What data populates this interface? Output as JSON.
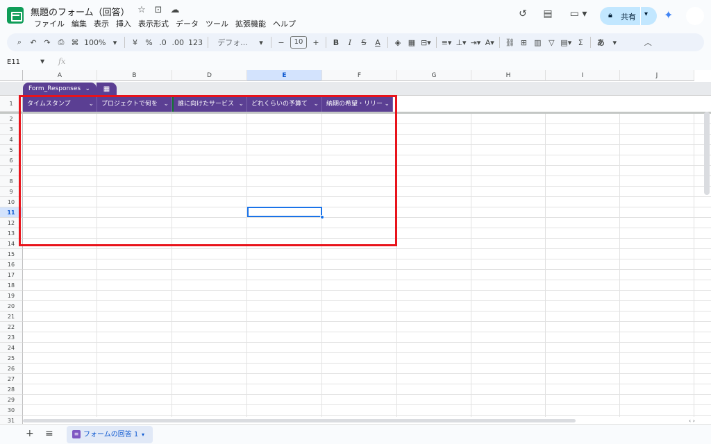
{
  "header": {
    "title": "無題のフォーム（回答）",
    "title_icons": [
      "star-icon",
      "folder-move-icon",
      "cloud-saved-icon"
    ],
    "menu": [
      "ファイル",
      "編集",
      "表示",
      "挿入",
      "表示形式",
      "データ",
      "ツール",
      "拡張機能",
      "ヘルプ"
    ],
    "share_label": "共有",
    "right_icons": [
      "history-icon",
      "comment-icon",
      "meet-icon"
    ]
  },
  "toolbar": {
    "zoom": "100%",
    "currency": "¥",
    "percent": "%",
    "decrease_decimal": ".0",
    "increase_decimal": ".00",
    "number_format": "123",
    "font_name": "デフォ...",
    "font_size": "10",
    "bold": "B",
    "italic": "I",
    "strike": "S",
    "text_color": "A",
    "input_tool": "あ",
    "minus": "−",
    "plus": "+"
  },
  "formula_bar": {
    "name_box": "E11",
    "fx": "fx",
    "value": ""
  },
  "grid": {
    "columns": [
      "A",
      "B",
      "D",
      "E",
      "F",
      "G",
      "H",
      "I",
      "J"
    ],
    "active_column": "E",
    "rows": [
      "1",
      "2",
      "3",
      "4",
      "5",
      "6",
      "7",
      "8",
      "9",
      "10",
      "11",
      "12",
      "13",
      "14",
      "15",
      "16",
      "17",
      "18",
      "19",
      "20",
      "21",
      "22",
      "23",
      "24",
      "25",
      "26",
      "27",
      "28",
      "29",
      "30",
      "31"
    ],
    "active_row": "11",
    "selected_cell": "E11"
  },
  "table": {
    "name": "Form_Responses",
    "headers": [
      "タイムスタンプ",
      "プロジェクトで何を",
      "誰に向けたサービス",
      "どれくらいの予算て",
      "納期の希望・リリー"
    ],
    "header_color": "#5b3f93",
    "highlight_color": "#e8131b"
  },
  "bottom_bar": {
    "sheet_tab": "フォームの回答 1",
    "add": "+",
    "all_sheets": "≡"
  }
}
